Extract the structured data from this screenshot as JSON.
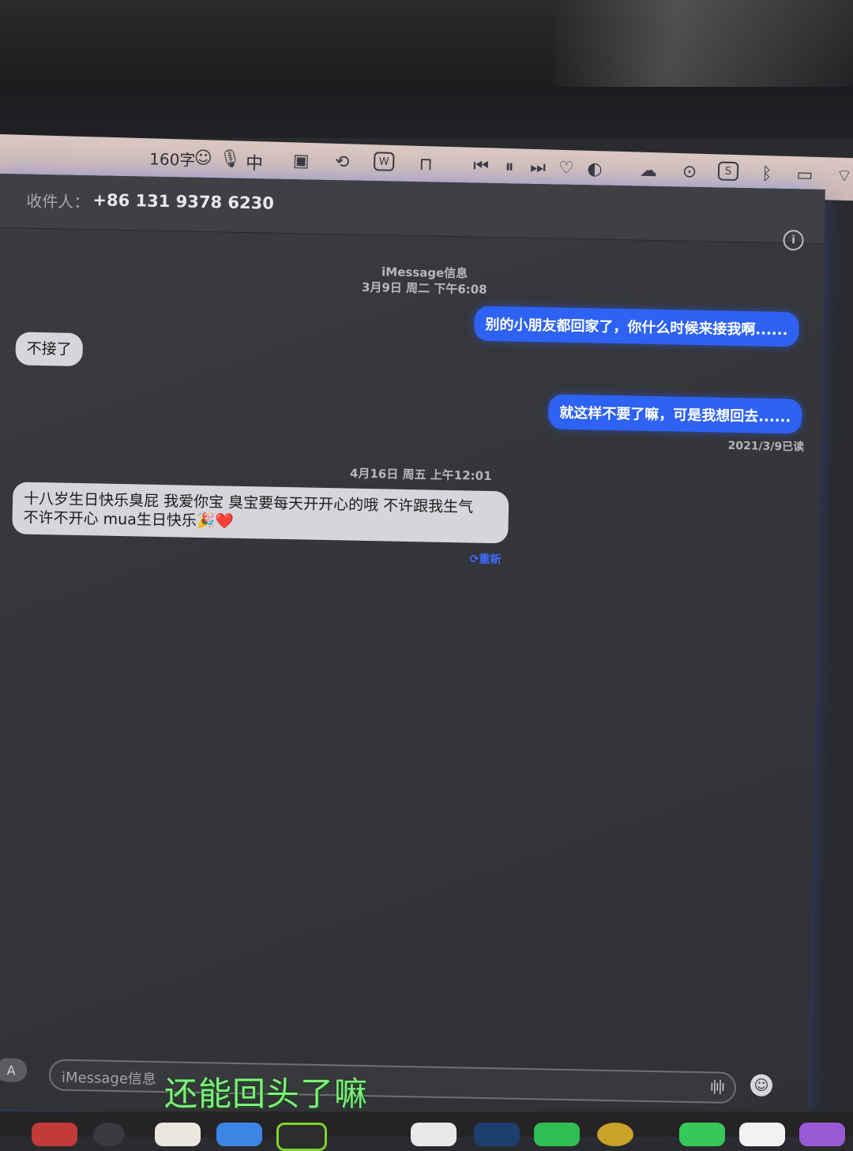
{
  "menubar": {
    "char_count": "160字",
    "input_method": "中"
  },
  "header": {
    "recipient_label": "收件人：",
    "recipient_value": "+86 131 9378 6230"
  },
  "conversation": {
    "service_label": "iMessage信息",
    "timestamp_1": "3月9日 周二 下午6:08",
    "messages_1": [
      {
        "from": "me",
        "text": "别的小朋友都回家了，你什么时候来接我啊......"
      },
      {
        "from": "them",
        "text": "不接了"
      },
      {
        "from": "me",
        "text": "就这样不要了嘛，可是我想回去......"
      }
    ],
    "read_receipt": "2021/3/9已读",
    "timestamp_2": "4月16日 周五 上午12:01",
    "message_2_line1": "十八岁生日快乐臭屁 我爱你宝 臭宝要每天开开心的哦 不许跟我生气",
    "message_2_line2": "不许不开心 mua生日快乐🎉❤️",
    "retry_label": "⟳重新"
  },
  "composer": {
    "placeholder": "iMessage信息"
  },
  "overlay": {
    "caption": "还能回头了嘛"
  },
  "colors": {
    "outgoing": "#2e62f2",
    "incoming": "#d6d6da",
    "caption": "#7df07d"
  }
}
